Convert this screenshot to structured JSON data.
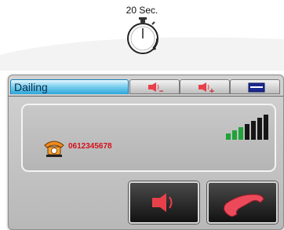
{
  "timer": {
    "label": "20 Sec."
  },
  "tabs": {
    "title": "Dailing",
    "volume_down_icon": "speaker-volume-down-icon",
    "volume_up_icon": "speaker-volume-up-icon",
    "menu_icon": "menu-bar-icon"
  },
  "call": {
    "number": "0612345678",
    "phone_icon": "orange-telephone-icon",
    "signal_bars": 7,
    "signal_active_green": 3
  },
  "buttons": {
    "speaker_icon": "speaker-icon",
    "hangup_icon": "hang-up-handset-icon"
  },
  "colors": {
    "accent_blue": "#2ea6da",
    "number_red": "#d4101a",
    "signal_green": "#1fa33a",
    "icon_red": "#e8404a"
  }
}
